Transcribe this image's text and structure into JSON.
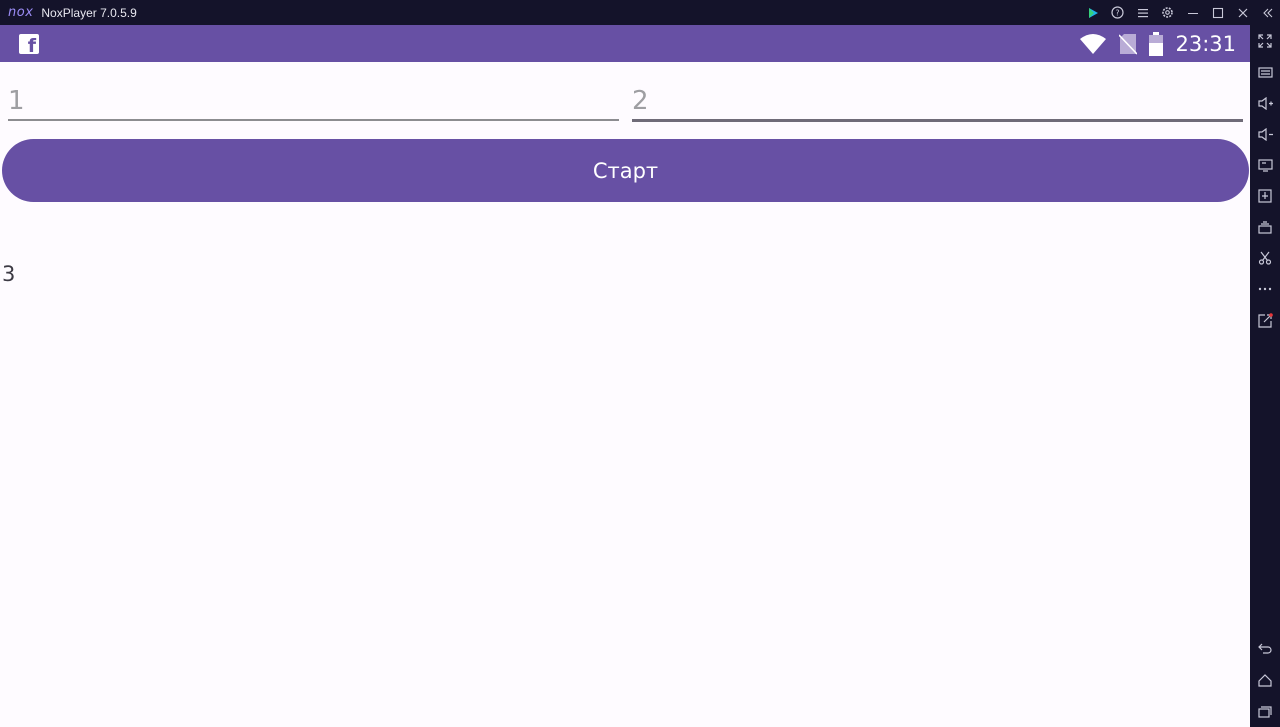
{
  "window": {
    "logo": "nox",
    "title": "NoxPlayer 7.0.5.9"
  },
  "statusbar": {
    "time": "23:31",
    "color": "#6750a4"
  },
  "inputs": {
    "first_placeholder": "1",
    "second_placeholder": "2"
  },
  "button": {
    "label": "Старт"
  },
  "result": {
    "text": "3"
  },
  "icons": {
    "titlebar": [
      "play-store-icon",
      "help-icon",
      "menu-icon",
      "settings-icon",
      "minimize-icon",
      "maximize-icon",
      "close-icon",
      "collapse-sidebar-icon"
    ],
    "sidebar": [
      "fullscreen-icon",
      "keyboard-icon",
      "volume-up-icon",
      "volume-down-icon",
      "screen-icon",
      "apk-install-icon",
      "multi-instance-icon",
      "screenshot-icon",
      "more-icon",
      "external-link-icon",
      "back-icon",
      "home-icon",
      "recent-apps-icon"
    ]
  }
}
